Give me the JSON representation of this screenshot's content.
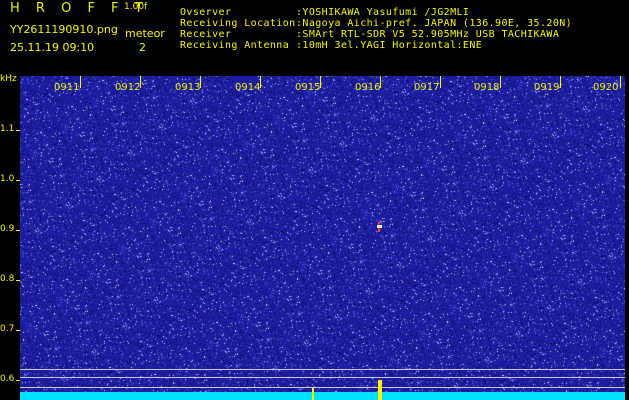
{
  "header": {
    "app_title": "H R O F F T",
    "app_version": "1.00f",
    "file_name": "YY2611190910.png",
    "timestamp": "25.11.19 09:10",
    "meteor_label": "meteor",
    "meteor_count": "2"
  },
  "info": {
    "observer_key": "Ovserver",
    "observer_val": ":YOSHIKAWA Yasufumi /JG2MLI",
    "location_key": "Receiving Location",
    "location_val": ":Nagoya Aichi-pref. JAPAN (136.90E, 35.20N)",
    "receiver_key": "Receiver",
    "receiver_val": ":SMArt RTL-SDR V5 52.905MHz USB TACHIKAWA",
    "antenna_key": "Receiving Antenna",
    "antenna_val": ":10mH 3el.YAGI Horizontal:ENE"
  },
  "axis": {
    "unit": "kHz",
    "y_labels": [
      "1.1",
      "1.0",
      "0.9",
      "0.8",
      "0.7",
      "0.6"
    ],
    "x_labels": [
      "0911",
      "0912",
      "0913",
      "0914",
      "0915",
      "0916",
      "0917",
      "0918",
      "0919",
      "0920"
    ]
  },
  "colors": {
    "background": "#20209a",
    "label": "#f6f600",
    "baseline": "#00e0ff"
  }
}
